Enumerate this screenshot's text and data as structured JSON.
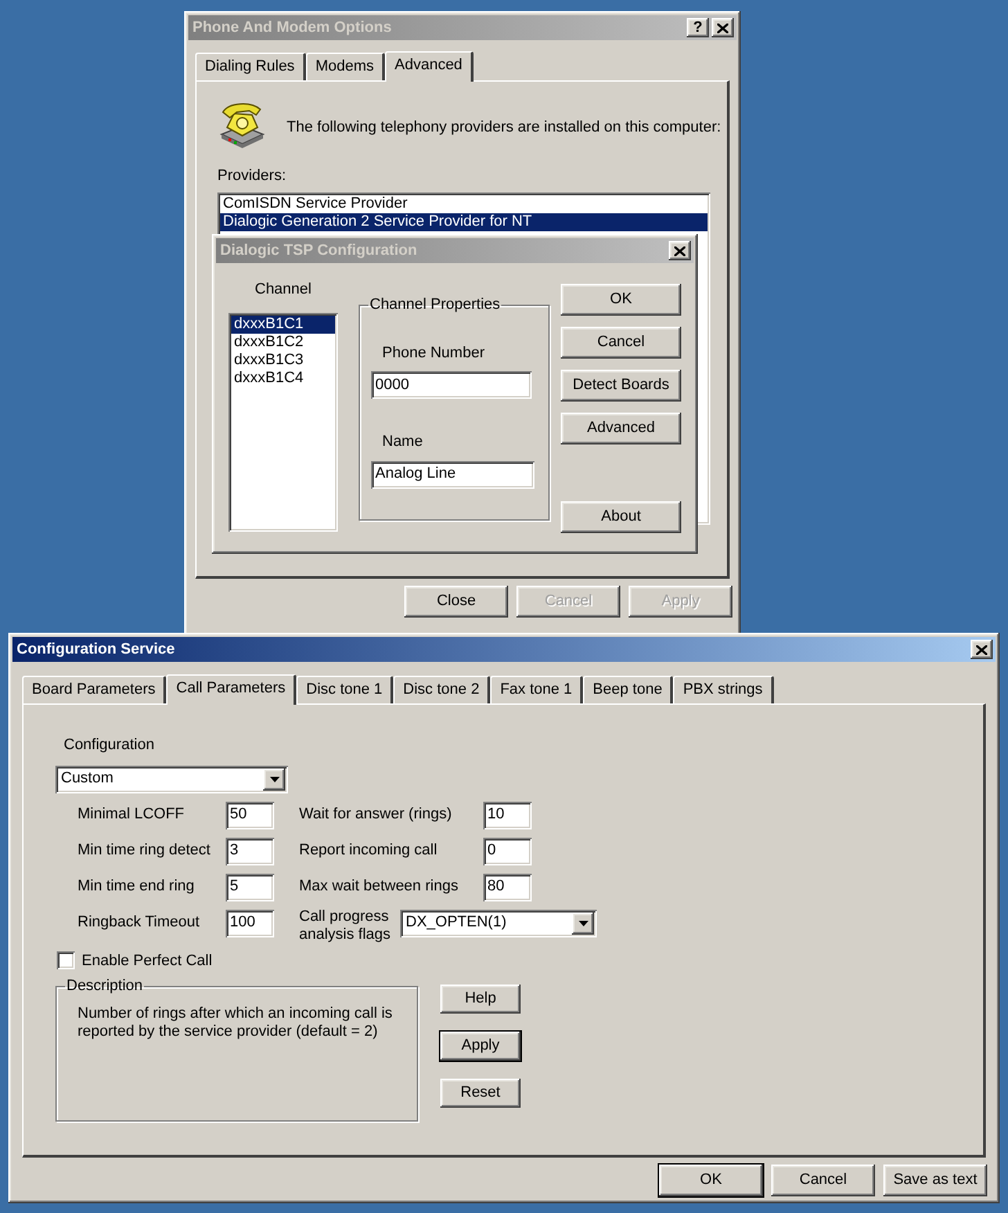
{
  "phone_modem_options": {
    "title": "Phone And Modem Options",
    "active": false,
    "help_button": "?",
    "tabs": [
      {
        "label": "Dialing Rules",
        "selected": false
      },
      {
        "label": "Modems",
        "selected": false
      },
      {
        "label": "Advanced",
        "selected": true
      }
    ],
    "intro_text": "The following telephony providers are installed on this computer:",
    "providers_label": "Providers:",
    "providers": [
      {
        "label": "ComISDN Service Provider",
        "selected": false
      },
      {
        "label": "Dialogic Generation 2 Service Provider for NT",
        "selected": true
      }
    ],
    "buttons": [
      {
        "label": "Close",
        "disabled": false
      },
      {
        "label": "Cancel",
        "disabled": true
      },
      {
        "label": "Apply",
        "disabled": true
      }
    ]
  },
  "tsp_configuration": {
    "title": "Dialogic TSP Configuration",
    "active": false,
    "channel_label": "Channel",
    "channels": [
      {
        "label": "dxxxB1C1",
        "selected": true
      },
      {
        "label": "dxxxB1C2",
        "selected": false
      },
      {
        "label": "dxxxB1C3",
        "selected": false
      },
      {
        "label": "dxxxB1C4",
        "selected": false
      }
    ],
    "channel_properties": {
      "title": "Channel Properties",
      "phone_number_label": "Phone Number",
      "phone_number": "0000",
      "name_label": "Name",
      "name": "Analog Line"
    },
    "buttons": [
      "OK",
      "Cancel",
      "Detect Boards",
      "Advanced"
    ],
    "about_button": "About"
  },
  "configuration_service": {
    "title": "Configuration Service",
    "active": true,
    "tabs": [
      {
        "label": "Board Parameters",
        "selected": false
      },
      {
        "label": "Call Parameters",
        "selected": true
      },
      {
        "label": "Disc tone 1",
        "selected": false
      },
      {
        "label": "Disc tone 2",
        "selected": false
      },
      {
        "label": "Fax tone 1",
        "selected": false
      },
      {
        "label": "Beep tone",
        "selected": false
      },
      {
        "label": "PBX strings",
        "selected": false
      }
    ],
    "configuration_label": "Configuration",
    "configuration_value": "Custom",
    "rows": [
      {
        "label": "Minimal LCOFF",
        "value": "50",
        "right_label": "Wait for answer (rings)",
        "right_value": "10"
      },
      {
        "label": "Min time ring detect",
        "value": "3",
        "right_label": "Report incoming call",
        "right_value": "0"
      },
      {
        "label": "Min time end ring",
        "value": "5",
        "right_label": "Max wait between rings",
        "right_value": "80"
      },
      {
        "label": "Ringback Timeout",
        "value": "100",
        "right_label": "Call progress analysis flags",
        "right_value": "DX_OPTEN(1)"
      }
    ],
    "enable_perfect_call": {
      "label": "Enable Perfect Call",
      "checked": false
    },
    "description": {
      "title": "Description",
      "text": "Number of rings after which an incoming call is reported by the service provider (default = 2)"
    },
    "side_buttons": [
      {
        "label": "Help",
        "default": false
      },
      {
        "label": "Apply",
        "default": true
      },
      {
        "label": "Reset",
        "default": false
      }
    ],
    "bottom_buttons": [
      {
        "label": "OK",
        "default": true
      },
      {
        "label": "Cancel",
        "default": false
      },
      {
        "label": "Save as text",
        "default": false
      }
    ]
  }
}
